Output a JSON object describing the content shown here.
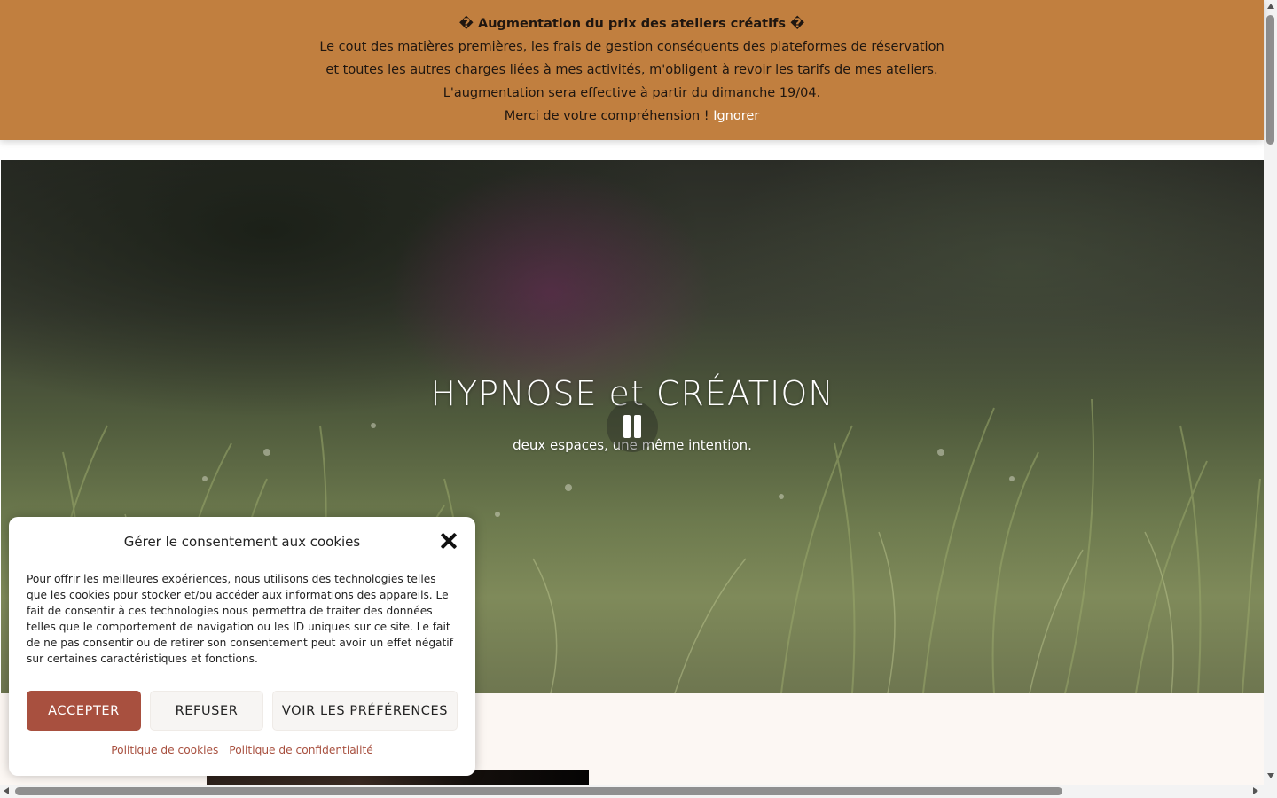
{
  "notice": {
    "title": "� Augmentation du prix des ateliers créatifs �",
    "line1": "Le cout des matières premières, les frais de gestion conséquents des plateformes de réservation",
    "line2": "et toutes les autres charges liées à mes activités, m'obligent à revoir les tarifs de mes ateliers.",
    "line3": "L'augmentation sera effective à partir du dimanche 19/04.",
    "line4": "Merci de votre compréhension !",
    "dismiss_label": "Ignorer",
    "background_color": "#c17f3f"
  },
  "hero": {
    "title": "HYPNOSE et CRÉATION",
    "subtitle": "deux espaces, une même intention.",
    "video_control": "pause-icon"
  },
  "cookie_banner": {
    "title": "Gérer le consentement aux cookies",
    "close_icon": "close-icon",
    "body": "Pour offrir les meilleures expériences, nous utilisons des technologies telles que les cookies pour stocker et/ou accéder aux informations des appareils. Le fait de consentir à ces technologies nous permettra de traiter des données telles que le comportement de navigation ou les ID uniques sur ce site. Le fait de ne pas consentir ou de retirer son consentement peut avoir un effet négatif sur certaines caractéristiques et fonctions.",
    "accept_label": "Accepter",
    "refuse_label": "Refuser",
    "preferences_label": "Voir les préférences",
    "cookie_policy_link": "Politique de cookies",
    "privacy_policy_link": "Politique de confidentialité",
    "accent_color": "#a8503f"
  }
}
